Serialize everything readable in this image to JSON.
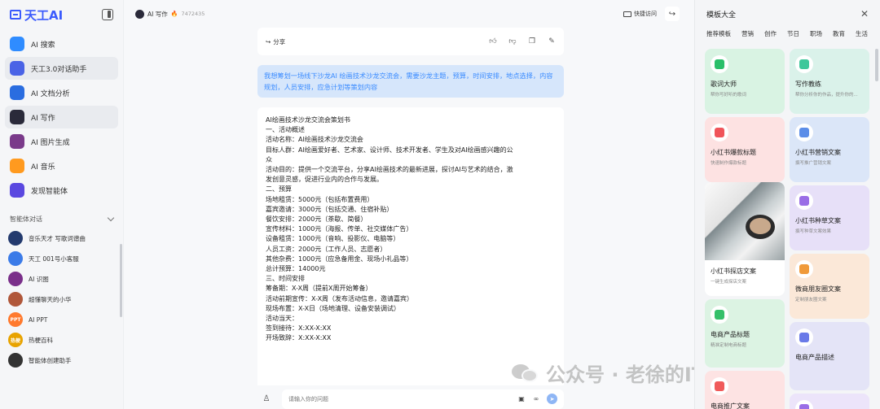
{
  "sidebar": {
    "logo": "天工AI",
    "nav": [
      {
        "label": "AI 搜索",
        "icon": "search-icon",
        "color": "#2f8cff"
      },
      {
        "label": "天工3.0对话助手",
        "icon": "chat-assistant-icon",
        "color": "#4a63e6"
      },
      {
        "label": "AI 文档分析",
        "icon": "document-icon",
        "color": "#2a6de0"
      },
      {
        "label": "AI 写作",
        "icon": "writing-icon",
        "color": "#2a2a3a"
      },
      {
        "label": "AI 图片生成",
        "icon": "image-gen-icon",
        "color": "#7a3a8a"
      },
      {
        "label": "AI 音乐",
        "icon": "music-icon",
        "color": "#ff9a1f"
      },
      {
        "label": "发现智能体",
        "icon": "agent-discover-icon",
        "color": "#5a48e0"
      }
    ],
    "agents_title": "智能体对话",
    "agents": [
      {
        "label": "音乐天才 写歌词谱曲",
        "color": "#233a6e",
        "mark": ""
      },
      {
        "label": "天工 001号小客服",
        "color": "#3b7be8",
        "mark": ""
      },
      {
        "label": "AI 识图",
        "color": "#7a2f8a",
        "mark": ""
      },
      {
        "label": "超懂聊天的小华",
        "color": "#b0573a",
        "mark": ""
      },
      {
        "label": "AI PPT",
        "color": "#ff7a2e",
        "mark": "PPT"
      },
      {
        "label": "热梗百科",
        "color": "#e8a300",
        "mark": "热梗"
      },
      {
        "label": "智能体创建助手",
        "color": "#333",
        "mark": ""
      }
    ]
  },
  "header": {
    "breadcrumb": "AI 写作",
    "count": "7472435",
    "quick_access": "快捷访问"
  },
  "chat": {
    "share_label": "分享",
    "user_message": "我想筹划一场线下沙龙AI 绘画技术沙龙交流会，需要沙龙主题，预算，时间安排，地点选择，内容规划，人员安排，应急计划等策划内容",
    "reply_lines": [
      "AI绘画技术沙龙交流会策划书",
      "一、活动概述",
      "活动名称：AI绘画技术沙龙交流会",
      "目标人群：AI绘画爱好者、艺术家、设计师、技术开发者、学生及对AI绘画感兴趣的公",
      "众",
      "活动目的：提供一个交流平台，分享AI绘画技术的最新进展，探讨AI与艺术的结合，激",
      "发创意灵感，促进行业内的合作与发展。",
      "二、预算",
      "场地租赁：5000元（包括布置费用）",
      "嘉宾邀请：3000元（包括交通、住宿补贴）",
      "餐饮安排：2000元（茶歇、简餐）",
      "宣传材料：1000元（海报、传单、社交媒体广告）",
      "设备租赁：1000元（音响、投影仪、电脑等）",
      "人员工资：2000元（工作人员、志愿者）",
      "其他杂费：1000元（应急备用金、现场小礼品等）",
      "总计预算：14000元",
      "三、时间安排",
      "筹备期：X-X周（提前X周开始筹备）",
      "活动前期宣传：X-X周（发布活动信息，邀请嘉宾）",
      "现场布置：X-X日（场地清理、设备安装调试）",
      "活动当天：",
      "签到接待：X:XX-X:XX",
      "开场致辞：X:XX-X:XX"
    ],
    "input_placeholder": "请输入你的问题"
  },
  "watermark": "公众号 · 老徐的IT技术生活",
  "panel": {
    "title": "模板大全",
    "tabs": [
      "推荐模板",
      "营销",
      "创作",
      "节日",
      "职场",
      "教育",
      "生活"
    ],
    "cards": [
      {
        "title": "歌词大师",
        "sub": "帮你写好听的歌词",
        "bg": "#d9f3e3",
        "icon": "lyrics-icon",
        "icolor": "#2bbf6a"
      },
      {
        "title": "写作教练",
        "sub": "帮你分析你的作品，提升你的...",
        "bg": "#daf2ea",
        "icon": "coach-icon",
        "icolor": "#3ec79a"
      },
      {
        "title": "小红书爆款标题",
        "sub": "快速制作爆款标题",
        "bg": "#fde2e2",
        "icon": "xhs-title-icon",
        "icolor": "#f0545a"
      },
      {
        "title": "小红书营销文案",
        "sub": "撰写推广营销文案",
        "bg": "#dbe6f8",
        "icon": "xhs-marketing-icon",
        "icolor": "#5b8de8"
      },
      {
        "title": "小红书探店文案",
        "sub": "一键生成探店文案",
        "bg": "#ffffff",
        "icon": "photo-card",
        "icolor": "#888"
      },
      {
        "title": "小红书种草文案",
        "sub": "撰写种草文案效果",
        "bg": "#e7e0f8",
        "icon": "xhs-seed-icon",
        "icolor": "#9a6ee6"
      },
      {
        "title": "电商产品标题",
        "sub": "精准定制电商标题",
        "bg": "#dcf3e3",
        "icon": "ecommerce-title-icon",
        "icolor": "#35c06a"
      },
      {
        "title": "微商朋友圈文案",
        "sub": "定制朋友圈文案",
        "bg": "#fbe8d8",
        "icon": "moments-icon",
        "icolor": "#f09a3a"
      },
      {
        "title": "电商推广文案",
        "sub": "",
        "bg": "#fde3e3",
        "icon": "ecommerce-promo-icon",
        "icolor": "#f05a5a"
      },
      {
        "title": "电商产品描述",
        "sub": "",
        "bg": "#e4e4f7",
        "icon": "product-desc-icon",
        "icolor": "#6a7ae8"
      },
      {
        "title": "",
        "sub": "",
        "bg": "#ece4fa",
        "icon": "misc-icon",
        "icolor": "#9a6ee6"
      }
    ]
  }
}
